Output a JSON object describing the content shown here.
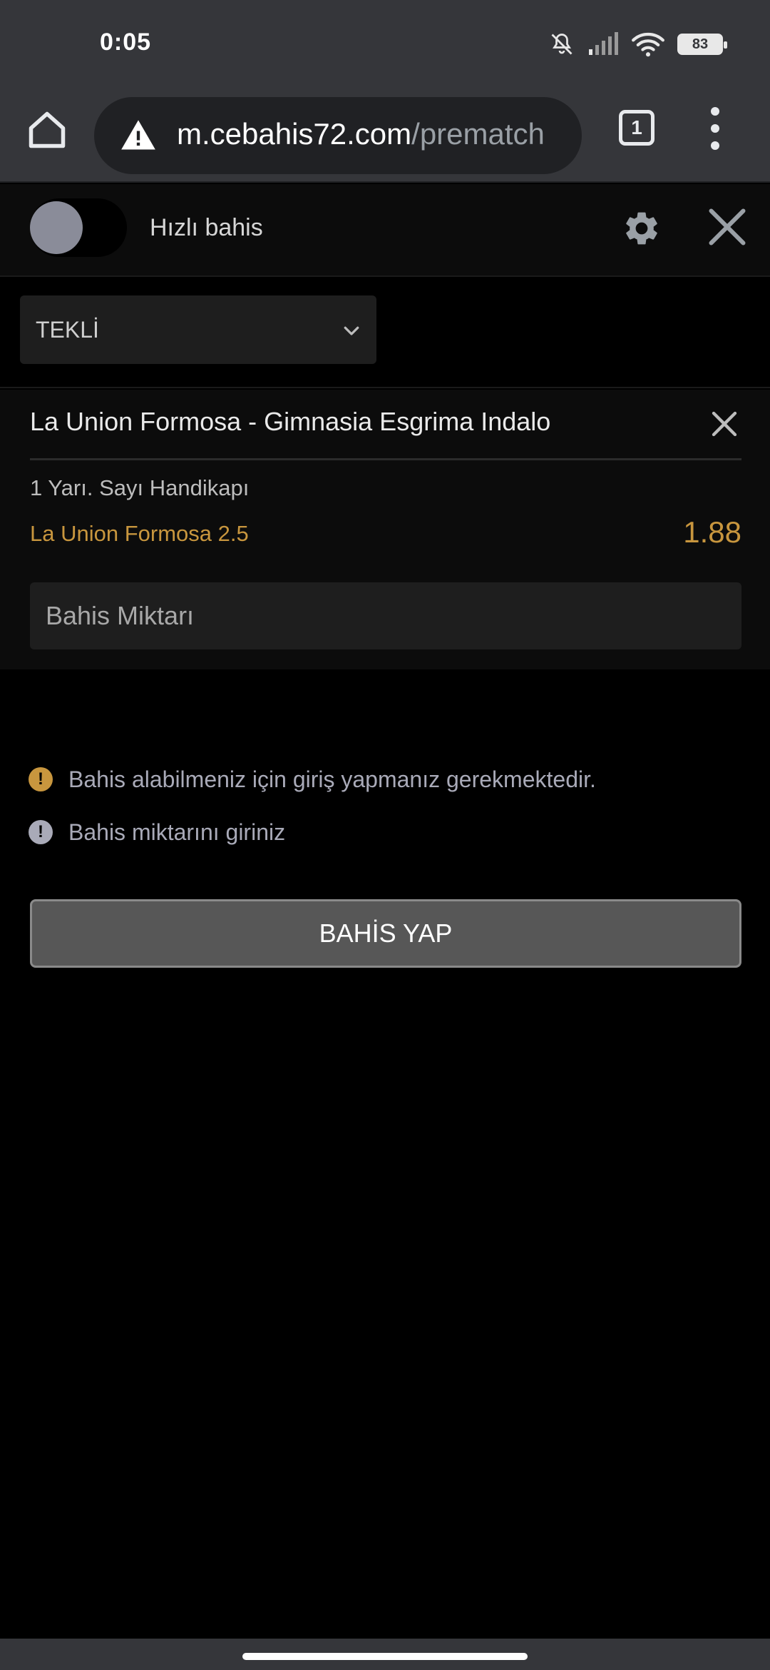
{
  "status_bar": {
    "time": "0:05",
    "battery": "83",
    "icons": [
      "mute-bell-icon",
      "signal-icon",
      "wifi-icon",
      "battery-icon"
    ]
  },
  "browser": {
    "url_domain": "m.cebahis72.com",
    "url_path": "/prematch",
    "tab_count": "1",
    "icons": [
      "home-icon",
      "warning-icon",
      "tab-switcher-icon",
      "overflow-menu-icon"
    ]
  },
  "header": {
    "quick_bet_label": "Hızlı bahis",
    "quick_bet_enabled": false,
    "icons": [
      "gear-icon",
      "close-icon"
    ]
  },
  "bet_type": {
    "selected": "TEKLİ"
  },
  "bet": {
    "match": "La Union Formosa - Gimnasia Esgrima Indalo",
    "market": "1 Yarı. Sayı Handikapı",
    "selection": "La Union Formosa 2.5",
    "odds": "1.88",
    "stake_placeholder": "Bahis Miktarı"
  },
  "messages": [
    {
      "text": "Bahis alabilmeniz için giriş yapmanız gerekmektedir.",
      "icon": "exclamation-icon",
      "color": "#c8963e"
    },
    {
      "text": "Bahis miktarını giriniz",
      "icon": "exclamation-icon",
      "color": "#a9aab8"
    }
  ],
  "submit": {
    "label": "BAHİS YAP"
  },
  "colors": {
    "accent": "#c8963e",
    "background": "#000000",
    "panel": "#0c0c0c",
    "browser_chrome": "#35363a"
  }
}
